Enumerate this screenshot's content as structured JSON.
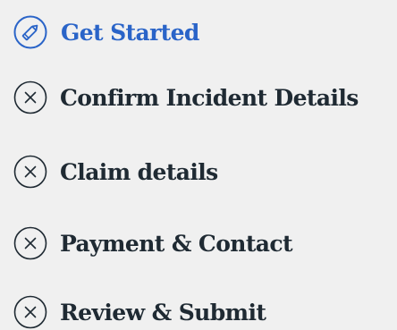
{
  "colors": {
    "active": "#2a64c8",
    "text": "#1f2a33",
    "background": "#f0f0f0"
  },
  "steps": [
    {
      "label": "Get Started",
      "state": "active",
      "icon": "pencil-icon"
    },
    {
      "label": "Confirm Incident Details",
      "state": "incomplete",
      "icon": "close-circle-icon"
    },
    {
      "label": "Claim details",
      "state": "incomplete",
      "icon": "close-circle-icon"
    },
    {
      "label": "Payment & Contact",
      "state": "incomplete",
      "icon": "close-circle-icon"
    },
    {
      "label": "Review & Submit",
      "state": "incomplete",
      "icon": "close-circle-icon"
    }
  ]
}
